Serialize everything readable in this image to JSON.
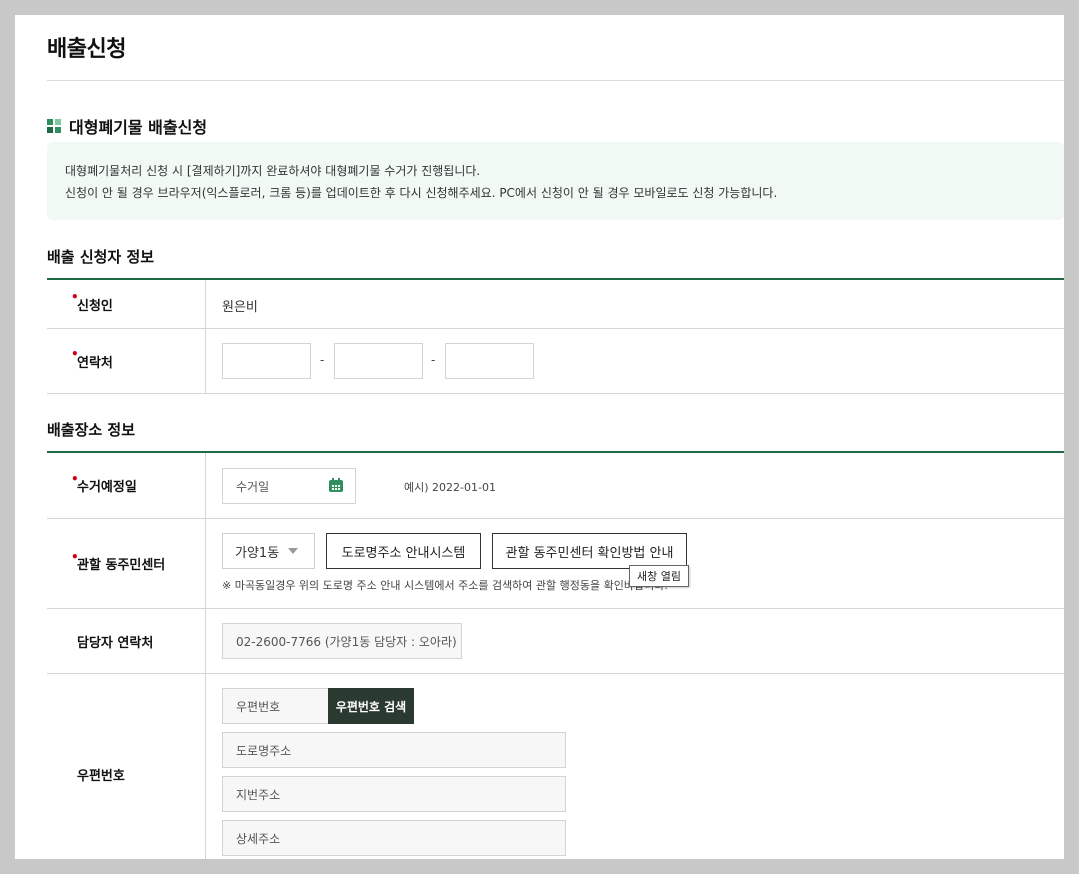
{
  "page": {
    "title": "배출신청"
  },
  "section": {
    "title": "대형폐기물 배출신청"
  },
  "notice": {
    "line1": "대형폐기물처리 신청 시 [결제하기]까지 완료하셔야 대형폐기물 수거가 진행됩니다.",
    "line2": "신청이 안 될 경우 브라우저(익스플로러, 크롬 등)를 업데이트한 후 다시 신청해주세요. PC에서 신청이 안 될 경우 모바일로도 신청 가능합니다."
  },
  "applicant": {
    "heading": "배출 신청자 정보",
    "name_label": "신청인",
    "name_value": "원은비",
    "contact_label": "연락처",
    "contact_dash1": "-",
    "contact_dash2": "-",
    "required_mark": "•"
  },
  "location": {
    "heading": "배출장소 정보",
    "date_label": "수거예정일",
    "date_placeholder": "수거일",
    "date_example": "예시) 2022-01-01",
    "center_label": "관할 동주민센터",
    "center_selected": "가양1동",
    "road_address_button": "도로명주소 안내시스템",
    "center_guide_button": "관할 동주민센터 확인방법 안내",
    "tooltip": "새창 열림",
    "center_note": "※ 마곡동일경우 위의 도로명 주소 안내 시스템에서 주소를 검색하여 관할 행정동을 확인바랍니다.",
    "manager_label": "담당자 연락처",
    "manager_value": "02-2600-7766 (가양1동 담당자 : 오아라)",
    "postal_label": "우편번호",
    "postal_placeholder": "우편번호",
    "postal_search_button": "우편번호 검색",
    "road_address_placeholder": "도로명주소",
    "lot_address_placeholder": "지번주소",
    "detail_address_placeholder": "상세주소"
  },
  "colors": {
    "accent": "#1f6a45",
    "notice_bg": "#f1f9f4",
    "required": "#d0021b",
    "dark_button": "#2b3a31"
  }
}
